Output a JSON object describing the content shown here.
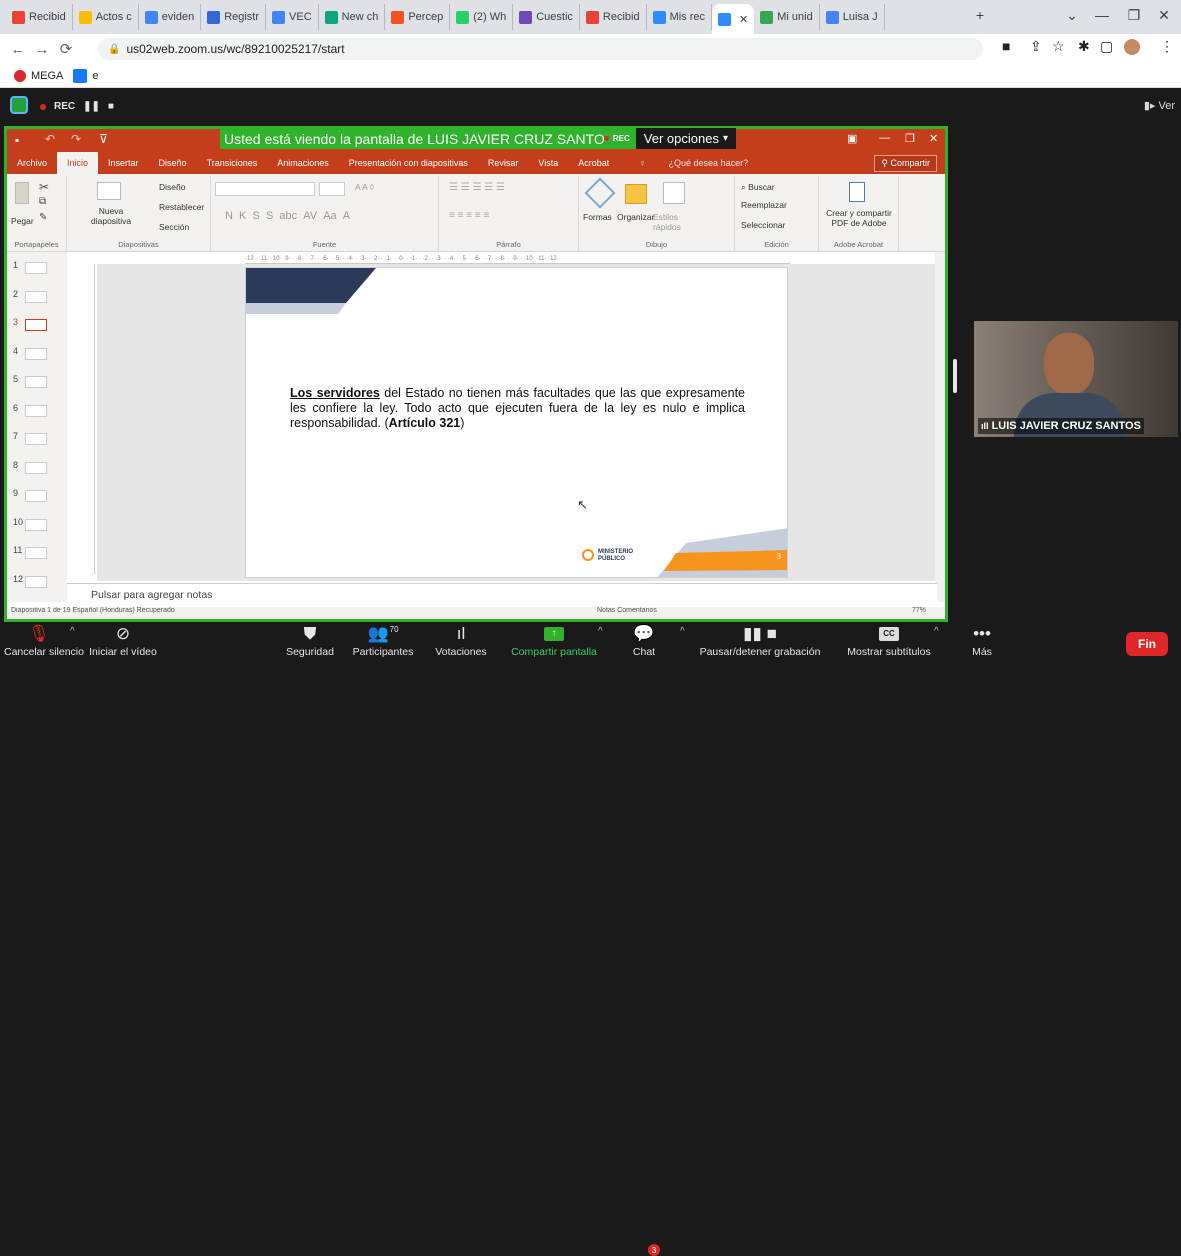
{
  "browser": {
    "tabs": [
      {
        "label": "Recibid",
        "color": "#ea4335"
      },
      {
        "label": "Actos c",
        "color": "#fbbc04"
      },
      {
        "label": "eviden",
        "color": "#4285f4"
      },
      {
        "label": "Registr",
        "color": "#3367d6"
      },
      {
        "label": "VEC",
        "color": "#4285f4"
      },
      {
        "label": "New ch",
        "color": "#10a37f"
      },
      {
        "label": "Percep",
        "color": "#f4511e"
      },
      {
        "label": "(2) Wh",
        "color": "#25d366"
      },
      {
        "label": "Cuestic",
        "color": "#7248b9"
      },
      {
        "label": "Recibid",
        "color": "#ea4335"
      },
      {
        "label": "Mis rec",
        "color": "#2d8cff"
      },
      {
        "label": "",
        "color": "#2d8cff"
      },
      {
        "label": "Mi unid",
        "color": "#34a853"
      },
      {
        "label": "Luisa J",
        "color": "#4285f4"
      }
    ],
    "url": "us02web.zoom.us/wc/89210025217/start",
    "bookmarks": [
      {
        "label": "MEGA",
        "color": "#d9272e"
      },
      {
        "label": "e",
        "color": "#1877f2"
      }
    ]
  },
  "zoom": {
    "rec_label": "REC",
    "view_label": "Ver",
    "banner_text": "Usted está viendo la pantalla de LUIS JAVIER CRUZ SANTOS",
    "banner_rec": "REC",
    "banner_options": "Ver opciones",
    "participant_name": "LUIS JAVIER CRUZ SANTOS",
    "toolbar": {
      "mute": "Cancelar silencio",
      "video": "Iniciar el vídeo",
      "security": "Seguridad",
      "participants": "Participantes",
      "participants_count": "70",
      "polls": "Votaciones",
      "share": "Compartir pantalla",
      "chat": "Chat",
      "chat_badge": "3",
      "record": "Pausar/detener grabación",
      "captions": "Mostrar subtítulos",
      "more": "Más",
      "end": "Fin"
    }
  },
  "ppt": {
    "ribbon_tabs": [
      "Archivo",
      "Inicio",
      "Insertar",
      "Diseño",
      "Transiciones",
      "Animaciones",
      "Presentación con diapositivas",
      "Revisar",
      "Vista",
      "Acrobat"
    ],
    "search_prompt": "¿Qué desea hacer?",
    "share_label": "Compartir",
    "groups": {
      "clipboard": "Portapapeles",
      "slides": "Diapositivas",
      "font": "Fuente",
      "paragraph": "Párrafo",
      "drawing": "Dibujo",
      "editing": "Edición",
      "acrobat": "Adobe Acrobat"
    },
    "commands": {
      "paste": "Pegar",
      "new_slide": "Nueva diapositiva",
      "layout": "Diseño",
      "reset": "Restablecer",
      "section": "Sección",
      "shapes": "Formas",
      "arrange": "Organizar",
      "quick_styles": "Estilos rápidos",
      "find": "Buscar",
      "replace": "Reemplazar",
      "select": "Seleccionar",
      "create_pdf": "Crear y compartir PDF de Adobe"
    },
    "thumbnails": [
      "1",
      "2",
      "3",
      "4",
      "5",
      "6",
      "7",
      "8",
      "9",
      "10",
      "11",
      "12"
    ],
    "current_slide": 3,
    "slide": {
      "bold_lead": "Los servidores",
      "body": " del Estado no tienen más facultades que las que expresamente les confiere la ley. Todo acto que ejecuten fuera de la ley es nulo e implica responsabilidad. (",
      "citation": "Artículo 321",
      "close": ")",
      "logo_line1": "MINISTERIO",
      "logo_line2": "PÚBLICO",
      "page_number": "3"
    },
    "notes_placeholder": "Pulsar para agregar notas",
    "status_text": "Diapositiva 1 de 19    Español (Honduras)    Recuperado",
    "status_right": "Notas    Comentarios",
    "zoom_level": "77%"
  }
}
